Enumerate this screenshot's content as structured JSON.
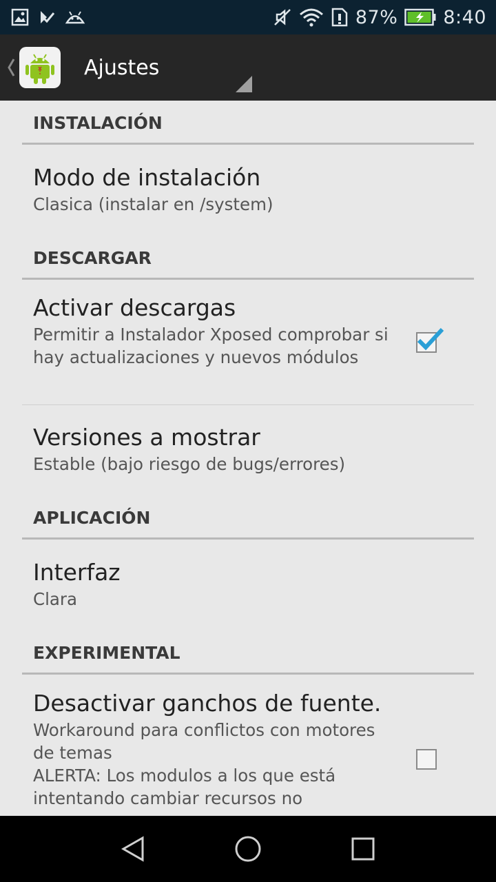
{
  "status_bar": {
    "battery_percent": "87%",
    "time": "8:40",
    "icons": [
      "gallery-icon",
      "check-icon",
      "android-icon",
      "mute-icon",
      "wifi-icon",
      "sim-alert-icon",
      "battery-charging-icon"
    ]
  },
  "action_bar": {
    "title": "Ajustes",
    "up_icon": "chevron-left-icon",
    "app_icon": "android-robot-icon"
  },
  "sections": {
    "install": {
      "header": "INSTALACIÓN",
      "items": [
        {
          "title": "Modo de instalación",
          "summary": "Clasica (instalar en /system)"
        }
      ]
    },
    "download": {
      "header": "DESCARGAR",
      "items": [
        {
          "title": "Activar descargas",
          "summary": "Permitir a Instalador Xposed comprobar si hay actualizaciones y nuevos módulos",
          "checked": true
        },
        {
          "title": "Versiones a mostrar",
          "summary": "Estable (bajo riesgo de bugs/errores)"
        }
      ]
    },
    "app": {
      "header": "APLICACIÓN",
      "items": [
        {
          "title": "Interfaz",
          "summary": "Clara"
        }
      ]
    },
    "experimental": {
      "header": "EXPERIMENTAL",
      "items": [
        {
          "title": "Desactivar ganchos de fuente.",
          "summary_line1": "Workaround para conflictos con motores de temas",
          "summary_line2": "ALERTA: Los modulos a los que está intentando cambiar recursos no",
          "checked": false
        }
      ]
    }
  },
  "colors": {
    "status_bar": "#0c2231",
    "action_bar": "#262626",
    "background": "#e8e8e8",
    "accent_check": "#2a9fd6"
  },
  "nav_bar": {
    "icons": [
      "back-icon",
      "home-icon",
      "recents-icon"
    ]
  }
}
